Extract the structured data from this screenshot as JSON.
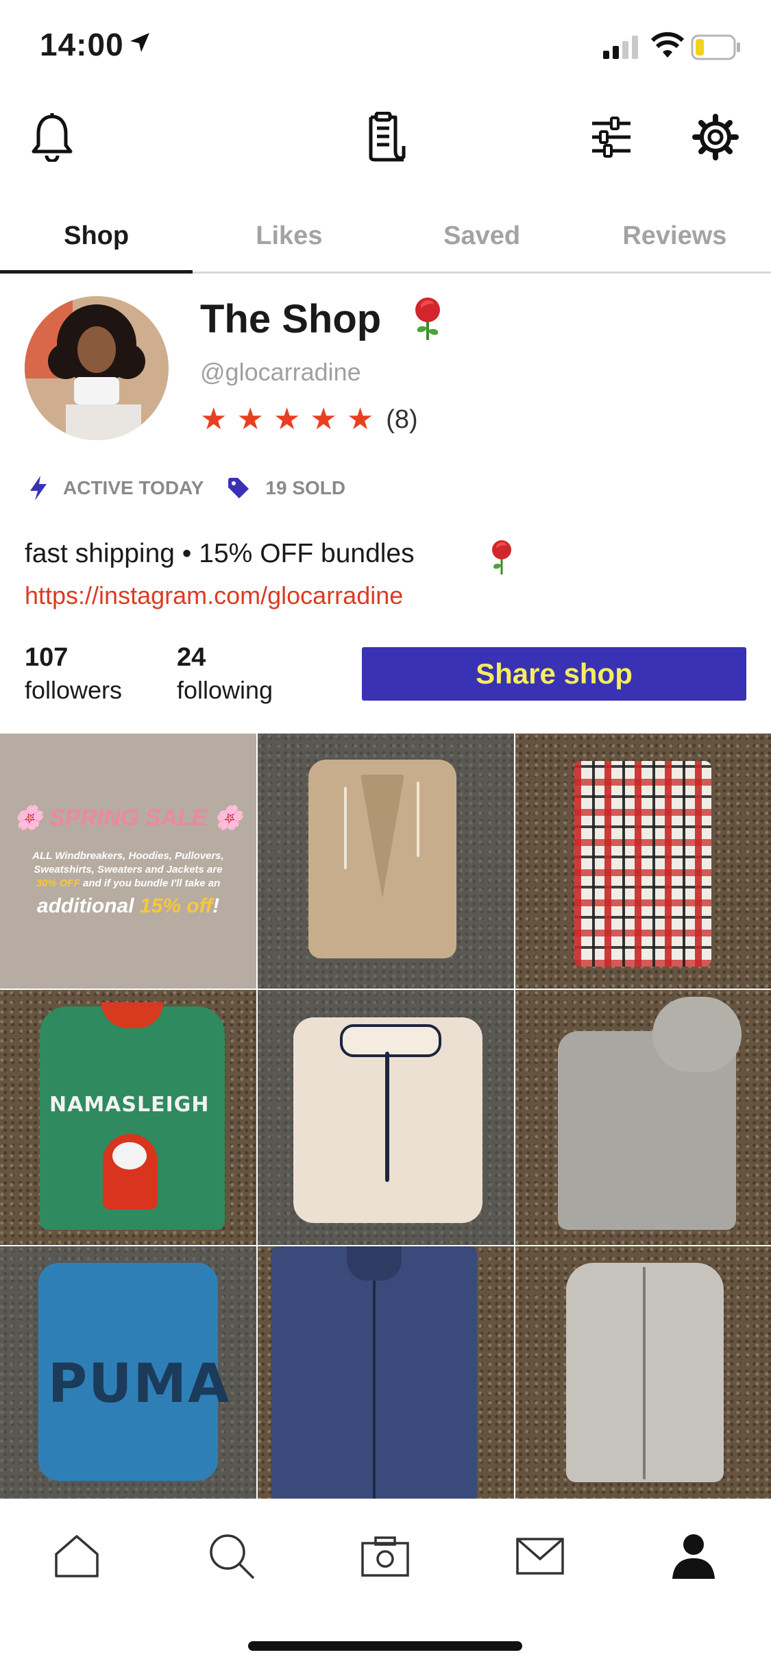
{
  "status_bar": {
    "time": "14:00"
  },
  "tabs": [
    {
      "label": "Shop"
    },
    {
      "label": "Likes"
    },
    {
      "label": "Saved"
    },
    {
      "label": "Reviews"
    }
  ],
  "profile": {
    "name": "The Shop",
    "handle": "@glocarradine",
    "rating": 5,
    "review_count": "(8)",
    "active": "ACTIVE TODAY",
    "sold": "19 SOLD",
    "bio": "fast shipping • 15% OFF bundles",
    "link": "https://instagram.com/glocarradine"
  },
  "stats": {
    "followers_count": "107",
    "followers_label": "followers",
    "following_count": "24",
    "following_label": "following"
  },
  "share_button": "Share shop",
  "promo": {
    "title": "SPRING SALE",
    "line1": "ALL Windbreakers, Hoodies, Pullovers,",
    "line2": "Sweatshirts, Sweaters and Jackets are",
    "line3_highlight": "30% OFF",
    "line3_rest": "and if you bundle I'll take an",
    "big_prefix": "additional",
    "big_highlight": "15% off",
    "big_suffix": "!"
  },
  "listings": [
    {
      "name": "tan-waffle-hoodie"
    },
    {
      "name": "plaid-flannel-shirt"
    },
    {
      "name": "namasleigh-sweater",
      "text": "NAMASLEIGH"
    },
    {
      "name": "pink-sherpa-pullover"
    },
    {
      "name": "grey-adidas-hoodie"
    },
    {
      "name": "blue-puma-hoodie",
      "text": "PUMA"
    },
    {
      "name": "navy-windbreaker"
    },
    {
      "name": "grey-columbia-fleece"
    }
  ],
  "colors": {
    "accent": "#ea3e21",
    "share_bg": "#3a32b5",
    "share_text": "#f6ee5a",
    "meta_icon": "#3a32b5"
  }
}
